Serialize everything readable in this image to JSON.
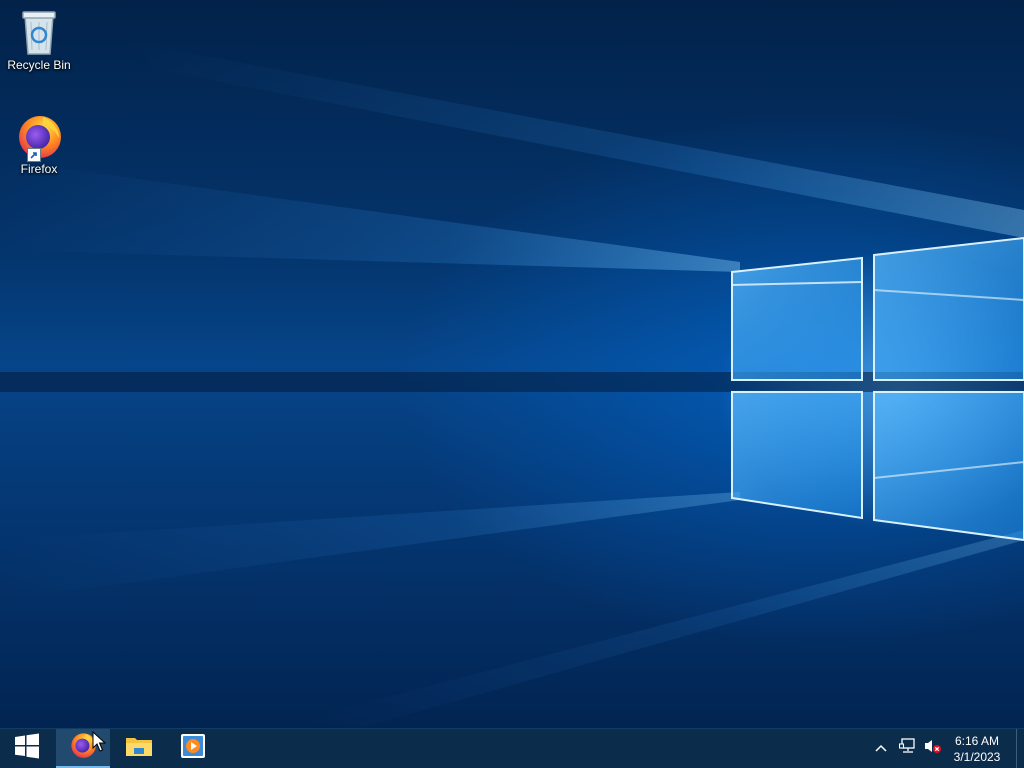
{
  "desktop": {
    "icons": [
      {
        "label": "Recycle Bin",
        "icon": "recycle-bin-icon"
      },
      {
        "label": "Firefox",
        "icon": "firefox-icon",
        "shortcut": true
      }
    ]
  },
  "taskbar": {
    "start": {
      "icon": "windows-logo-icon"
    },
    "pinned": [
      {
        "name": "Firefox",
        "icon": "firefox-icon",
        "active": true
      },
      {
        "name": "File Explorer",
        "icon": "folder-icon",
        "active": false
      },
      {
        "name": "Media Player",
        "icon": "media-player-icon",
        "active": false
      }
    ],
    "tray": {
      "icons": [
        "chevron-up-icon",
        "network-icon",
        "volume-muted-icon"
      ]
    },
    "clock": {
      "time": "6:16 AM",
      "date": "3/1/2023"
    }
  },
  "colors": {
    "taskbar_bg": "#0c2c4c",
    "accent": "#76b9ed",
    "wallpaper_light": "#6fc6ff"
  }
}
